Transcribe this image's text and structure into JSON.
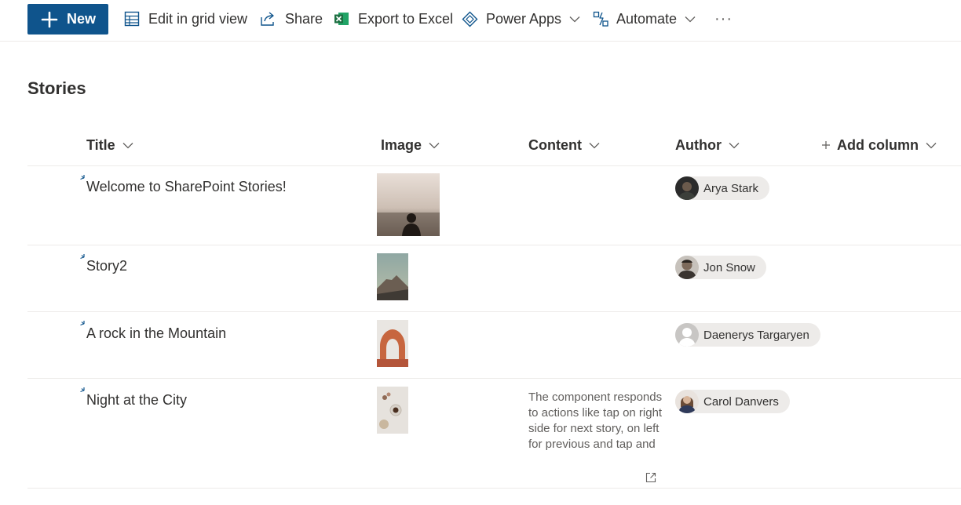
{
  "toolbar": {
    "new_label": "New",
    "edit_grid_label": "Edit in grid view",
    "share_label": "Share",
    "export_label": "Export to Excel",
    "powerapps_label": "Power Apps",
    "automate_label": "Automate",
    "more_label": "···"
  },
  "list_title": "Stories",
  "columns": {
    "title": "Title",
    "image": "Image",
    "content": "Content",
    "author": "Author",
    "add_column": "Add column"
  },
  "rows": [
    {
      "title": "Welcome to SharePoint Stories!",
      "content": "",
      "author": "Arya Stark"
    },
    {
      "title": "Story2",
      "content": "",
      "author": "Jon Snow"
    },
    {
      "title": "A rock in the Mountain",
      "content": "",
      "author": "Daenerys Targaryen"
    },
    {
      "title": "Night at the City",
      "content": "The component responds to actions like tap on right side for next story, on left for previous and tap and",
      "author": "Carol Danvers"
    }
  ],
  "colors": {
    "primary": "#0f548c",
    "persona_bg": "#edebe9",
    "excel_green": "#1d6f42"
  }
}
